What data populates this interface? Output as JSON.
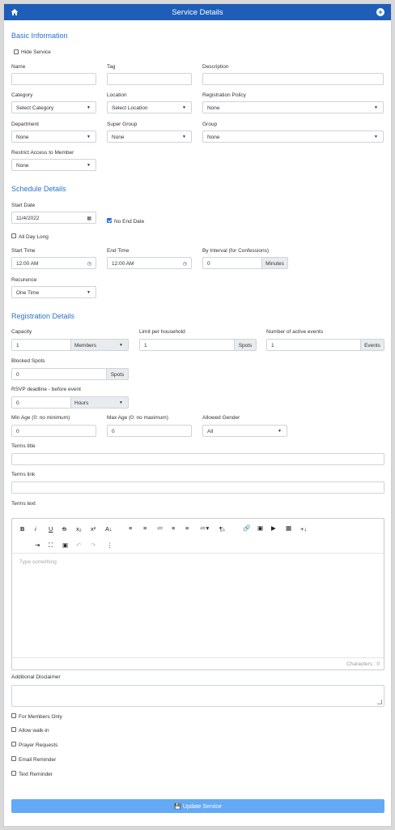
{
  "header": {
    "title": "Service Details",
    "home_icon": "home-icon",
    "add_icon": "plus-circle-icon",
    "accent": "#1e5eb8"
  },
  "basic": {
    "heading": "Basic Information",
    "hide_service": "Hide Service",
    "name_label": "Name",
    "tag_label": "Tag",
    "description_label": "Description",
    "category_label": "Category",
    "category_value": "Select Category",
    "location_label": "Location",
    "location_value": "Select Location",
    "reg_policy_label": "Registration Policy",
    "reg_policy_value": "None",
    "department_label": "Department",
    "department_value": "None",
    "super_group_label": "Super Group",
    "super_group_value": "None",
    "group_label": "Group",
    "group_value": "None",
    "restrict_label": "Restrict Access to Member",
    "restrict_value": "None"
  },
  "schedule": {
    "heading": "Schedule Details",
    "start_date_label": "Start Date",
    "start_date_value": "11/4/2022",
    "no_end_date": "No End Date",
    "all_day": "All Day Long",
    "start_time_label": "Start Time",
    "start_time_value": "12:00 AM",
    "end_time_label": "End Time",
    "end_time_value": "12:00 AM",
    "interval_label": "By Interval (for Confessions)",
    "interval_value": "0",
    "interval_unit": "Minutes",
    "recurrence_label": "Recurence",
    "recurrence_value": "One Time"
  },
  "registration": {
    "heading": "Registration Details",
    "capacity_label": "Capacity",
    "capacity_value": "1",
    "capacity_unit": "Members",
    "limit_label": "Limit per household",
    "limit_value": "1",
    "limit_unit": "Spots",
    "active_label": "Number of active events",
    "active_value": "1",
    "active_unit": "Events",
    "blocked_label": "Blocked Spots",
    "blocked_value": "0",
    "blocked_unit": "Spots",
    "rsvp_label": "RSVP deadline - before event",
    "rsvp_value": "0",
    "rsvp_unit": "Hours",
    "min_age_label": "Min Age (0: no minimum)",
    "min_age_value": "0",
    "max_age_label": "Max Age (0: no maximum)",
    "max_age_value": "0",
    "gender_label": "Allowed Gender",
    "gender_value": "All",
    "terms_title_label": "Terms title",
    "terms_link_label": "Terms link",
    "terms_text_label": "Terms text",
    "editor_placeholder": "Type something",
    "characters": "Characters : 0",
    "disclaimer_label": "Additional Disclaimer",
    "members_only": "For Members Only",
    "walk_in": "Allow walk-in",
    "prayer": "Prayer Requests",
    "email_reminder": "Email Reminder",
    "text_reminder": "Text Reminder"
  },
  "toolbar": {
    "bold": "B",
    "italic": "i",
    "underline": "U",
    "strike": "S",
    "sub": "x₂",
    "sup": "x²",
    "font": "A↓",
    "para": "¶↓",
    "insert": "+↓",
    "more": "⋮"
  },
  "submit": {
    "label": "💾 Update Service",
    "color": "#64a9f5"
  }
}
